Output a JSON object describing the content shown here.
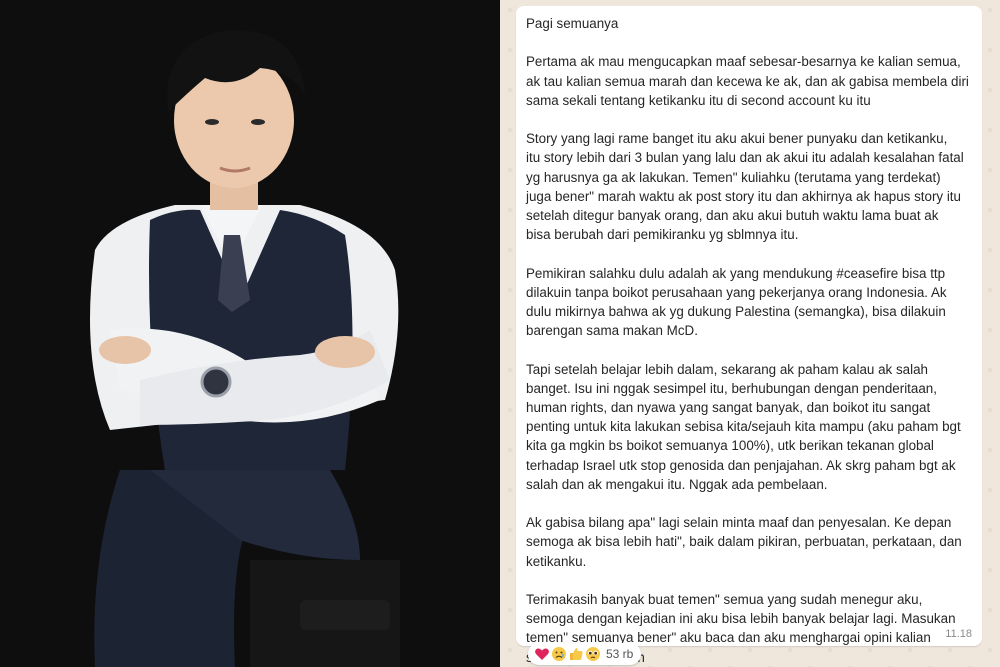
{
  "colors": {
    "chat_background": "#efe7dc",
    "bubble": "#ffffff",
    "text": "#262626",
    "timestamp": "#8a8a8a",
    "photo_background": "#0e0e0e"
  },
  "message": {
    "paragraphs": [
      [
        "Pagi semuanya"
      ],
      [
        "Pertama ak mau mengucapkan maaf sebesar-besarnya ke kalian semua,",
        "ak tau kalian semua marah dan kecewa ke ak, dan ak gabisa membela diri",
        "sama sekali tentang ketikanku itu di second account ku itu"
      ],
      [
        "Story yang lagi rame banget itu aku akui bener punyaku dan ketikanku,",
        "itu story lebih dari 3 bulan yang lalu dan ak akui itu adalah kesalahan fatal",
        "yg harusnya ga ak lakukan. Temen\" kuliahku (terutama yang terdekat)",
        "juga bener\" marah waktu ak post story itu dan akhirnya ak hapus story itu",
        "setelah ditegur banyak orang, dan aku akui butuh waktu lama buat ak",
        "bisa berubah dari pemikiranku yg sblmnya itu."
      ],
      [
        "Pemikiran salahku dulu adalah ak yang mendukung #ceasefire bisa ttp",
        "dilakuin tanpa boikot perusahaan yang pekerjanya orang Indonesia. Ak",
        "dulu mikirnya bahwa ak yg dukung Palestina (semangka), bisa dilakuin",
        "barengan sama makan McD."
      ],
      [
        "Tapi setelah belajar lebih dalam, sekarang ak paham kalau ak salah",
        "banget. Isu ini nggak sesimpel itu, berhubungan dengan penderitaan,",
        "human rights, dan nyawa yang sangat banyak, dan boikot itu sangat",
        "penting untuk kita lakukan sebisa kita/sejauh kita mampu (aku paham bgt",
        "kita ga mgkin bs boikot semuanya 100%), utk berikan tekanan global",
        "terhadap Israel utk stop genosida dan penjajahan. Ak skrg paham bgt ak",
        "salah dan ak mengakui itu. Nggak ada pembelaan."
      ],
      [
        "Ak gabisa bilang apa\" lagi selain minta maaf dan penyesalan. Ke depan",
        "semoga ak bisa lebih hati\", baik dalam pikiran, perbuatan, perkataan, dan",
        "ketikanku."
      ],
      [
        "Terimakasih banyak buat temen\" semua yang sudah menegur aku,",
        "semoga dengan kejadian ini aku bisa lebih banyak belajar lagi. Masukan",
        "temen\" semuanya bener\" aku baca dan aku menghargai opini kalian",
        "semua. Terimakasih"
      ]
    ],
    "timestamp": "11.18"
  },
  "reactions": {
    "icons": [
      "red-heart-icon",
      "sad-face-icon",
      "thumbs-up-icon",
      "pleading-face-icon"
    ],
    "count": "53 rb"
  }
}
